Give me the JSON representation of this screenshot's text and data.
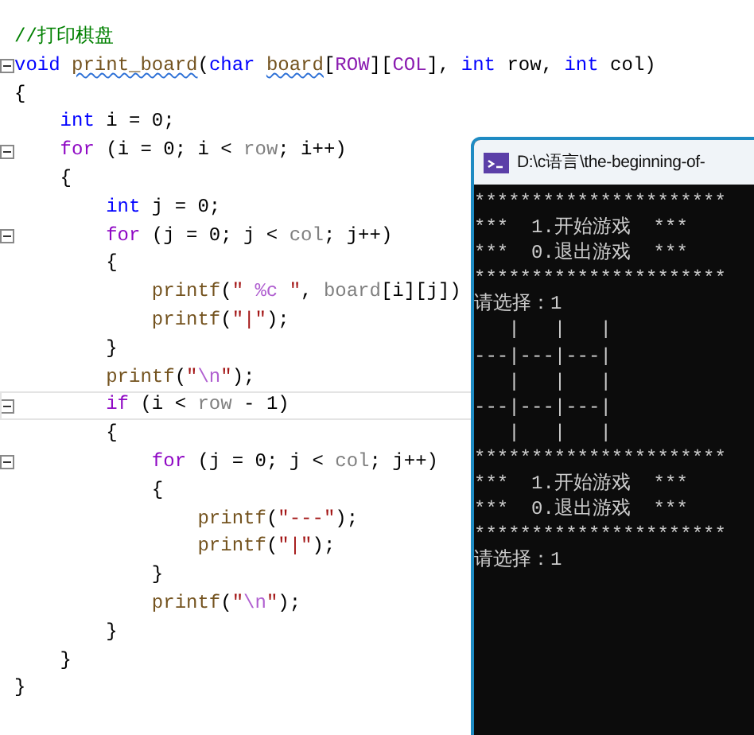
{
  "editor": {
    "lines": [
      {
        "fold": false,
        "current": false,
        "tokens": [
          {
            "kind": "comment",
            "text": "//打印棋盘"
          }
        ]
      },
      {
        "fold": true,
        "current": false,
        "tokens": [
          {
            "kind": "type",
            "text": "void "
          },
          {
            "kind": "squiggle",
            "text": "print_board"
          },
          {
            "kind": "plain",
            "text": "("
          },
          {
            "kind": "type",
            "text": "char "
          },
          {
            "kind": "squiggle",
            "text": "board"
          },
          {
            "kind": "plain",
            "text": "["
          },
          {
            "kind": "macro",
            "text": "ROW"
          },
          {
            "kind": "plain",
            "text": "]["
          },
          {
            "kind": "macro",
            "text": "COL"
          },
          {
            "kind": "plain",
            "text": "], "
          },
          {
            "kind": "type",
            "text": "int"
          },
          {
            "kind": "plain",
            "text": " row, "
          },
          {
            "kind": "type",
            "text": "int"
          },
          {
            "kind": "plain",
            "text": " col)"
          }
        ]
      },
      {
        "fold": false,
        "current": false,
        "tokens": [
          {
            "kind": "plain",
            "text": "{"
          }
        ]
      },
      {
        "fold": false,
        "current": false,
        "tokens": [
          {
            "kind": "type",
            "text": "    int"
          },
          {
            "kind": "plain",
            "text": " i = 0;"
          }
        ]
      },
      {
        "fold": true,
        "current": false,
        "tokens": [
          {
            "kind": "control",
            "text": "    for"
          },
          {
            "kind": "plain",
            "text": " (i = 0; i < "
          },
          {
            "kind": "param",
            "text": "row"
          },
          {
            "kind": "plain",
            "text": "; i++)"
          }
        ]
      },
      {
        "fold": false,
        "current": false,
        "tokens": [
          {
            "kind": "plain",
            "text": "    {"
          }
        ]
      },
      {
        "fold": false,
        "current": false,
        "tokens": [
          {
            "kind": "type",
            "text": "        int"
          },
          {
            "kind": "plain",
            "text": " j = 0;"
          }
        ]
      },
      {
        "fold": true,
        "current": false,
        "tokens": [
          {
            "kind": "control",
            "text": "        for"
          },
          {
            "kind": "plain",
            "text": " (j = 0; j < "
          },
          {
            "kind": "param",
            "text": "col"
          },
          {
            "kind": "plain",
            "text": "; j++)"
          }
        ]
      },
      {
        "fold": false,
        "current": false,
        "tokens": [
          {
            "kind": "plain",
            "text": "        {"
          }
        ]
      },
      {
        "fold": false,
        "current": false,
        "tokens": [
          {
            "kind": "func",
            "text": "            printf"
          },
          {
            "kind": "plain",
            "text": "("
          },
          {
            "kind": "string",
            "text": "\" "
          },
          {
            "kind": "escape",
            "text": "%c"
          },
          {
            "kind": "string",
            "text": " \""
          },
          {
            "kind": "plain",
            "text": ", "
          },
          {
            "kind": "param",
            "text": "board"
          },
          {
            "kind": "plain",
            "text": "[i][j])"
          }
        ]
      },
      {
        "fold": false,
        "current": false,
        "tokens": [
          {
            "kind": "func",
            "text": "            printf"
          },
          {
            "kind": "plain",
            "text": "("
          },
          {
            "kind": "string",
            "text": "\"|\""
          },
          {
            "kind": "plain",
            "text": ");"
          }
        ]
      },
      {
        "fold": false,
        "current": false,
        "tokens": [
          {
            "kind": "plain",
            "text": "        }"
          }
        ]
      },
      {
        "fold": false,
        "current": false,
        "tokens": [
          {
            "kind": "func",
            "text": "        printf"
          },
          {
            "kind": "plain",
            "text": "("
          },
          {
            "kind": "string",
            "text": "\""
          },
          {
            "kind": "escape",
            "text": "\\n"
          },
          {
            "kind": "string",
            "text": "\""
          },
          {
            "kind": "plain",
            "text": ");"
          }
        ]
      },
      {
        "fold": true,
        "current": true,
        "tokens": [
          {
            "kind": "control",
            "text": "        if"
          },
          {
            "kind": "plain",
            "text": " (i < "
          },
          {
            "kind": "param",
            "text": "row"
          },
          {
            "kind": "plain",
            "text": " - 1)"
          }
        ]
      },
      {
        "fold": false,
        "current": false,
        "tokens": [
          {
            "kind": "plain",
            "text": "        {"
          }
        ]
      },
      {
        "fold": true,
        "current": false,
        "tokens": [
          {
            "kind": "control",
            "text": "            for"
          },
          {
            "kind": "plain",
            "text": " (j = 0; j < "
          },
          {
            "kind": "param",
            "text": "col"
          },
          {
            "kind": "plain",
            "text": "; j++)"
          }
        ]
      },
      {
        "fold": false,
        "current": false,
        "tokens": [
          {
            "kind": "plain",
            "text": "            {"
          }
        ]
      },
      {
        "fold": false,
        "current": false,
        "tokens": [
          {
            "kind": "func",
            "text": "                printf"
          },
          {
            "kind": "plain",
            "text": "("
          },
          {
            "kind": "string",
            "text": "\"---\""
          },
          {
            "kind": "plain",
            "text": ");"
          }
        ]
      },
      {
        "fold": false,
        "current": false,
        "tokens": [
          {
            "kind": "func",
            "text": "                printf"
          },
          {
            "kind": "plain",
            "text": "("
          },
          {
            "kind": "string",
            "text": "\"|\""
          },
          {
            "kind": "plain",
            "text": ");"
          }
        ]
      },
      {
        "fold": false,
        "current": false,
        "tokens": [
          {
            "kind": "plain",
            "text": "            }"
          }
        ]
      },
      {
        "fold": false,
        "current": false,
        "tokens": [
          {
            "kind": "func",
            "text": "            printf"
          },
          {
            "kind": "plain",
            "text": "("
          },
          {
            "kind": "string",
            "text": "\""
          },
          {
            "kind": "escape",
            "text": "\\n"
          },
          {
            "kind": "string",
            "text": "\""
          },
          {
            "kind": "plain",
            "text": ");"
          }
        ]
      },
      {
        "fold": false,
        "current": false,
        "tokens": [
          {
            "kind": "plain",
            "text": "        }"
          }
        ]
      },
      {
        "fold": false,
        "current": false,
        "tokens": [
          {
            "kind": "plain",
            "text": "    }"
          }
        ]
      },
      {
        "fold": false,
        "current": false,
        "tokens": [
          {
            "kind": "plain",
            "text": "}"
          }
        ]
      }
    ]
  },
  "console": {
    "title": "D:\\c语言\\the-beginning-of-",
    "lines": [
      "**********************",
      "***  1.开始游戏  ***",
      "***  0.退出游戏  ***",
      "**********************",
      "请选择：1",
      "   |   |   |",
      "---|---|---|",
      "   |   |   |",
      "---|---|---|",
      "   |   |   |",
      "**********************",
      "***  1.开始游戏  ***",
      "***  0.退出游戏  ***",
      "**********************",
      "请选择：1"
    ]
  }
}
